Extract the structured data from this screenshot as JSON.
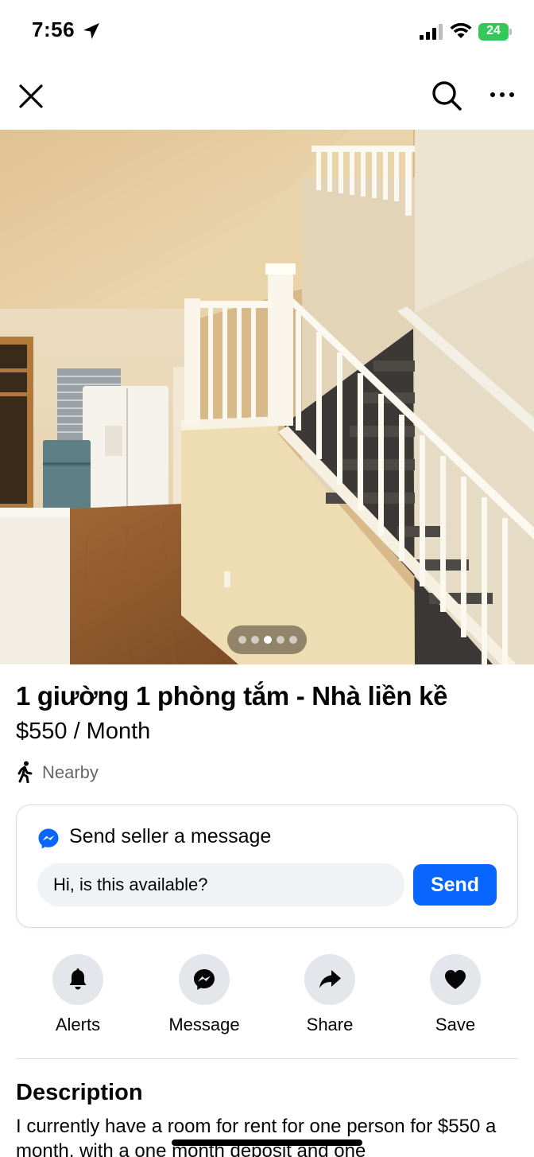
{
  "status_bar": {
    "time": "7:56",
    "battery": "24"
  },
  "nav": {
    "close_icon": "close-icon",
    "search_icon": "search-icon",
    "more_icon": "more-icon"
  },
  "photo": {
    "pager_count": 5,
    "pager_active_index": 2
  },
  "listing": {
    "title": "1 giường 1 phòng tắm - Nhà liền kề",
    "price": "$550 / Month",
    "distance": "Nearby"
  },
  "message_card": {
    "title": "Send seller a message",
    "input_value": "Hi, is this available?",
    "send_label": "Send"
  },
  "actions": [
    {
      "label": "Alerts",
      "icon": "bell-icon"
    },
    {
      "label": "Message",
      "icon": "messenger-icon"
    },
    {
      "label": "Share",
      "icon": "share-icon"
    },
    {
      "label": "Save",
      "icon": "heart-icon"
    }
  ],
  "description": {
    "heading": "Description",
    "text": "I currently have a room for rent for one person for $550 a month, with a one month deposit and one"
  },
  "colors": {
    "accent": "#0866ff",
    "battery": "#34c759",
    "secondary_text": "#65676b",
    "action_circle": "#e4e6eb"
  }
}
